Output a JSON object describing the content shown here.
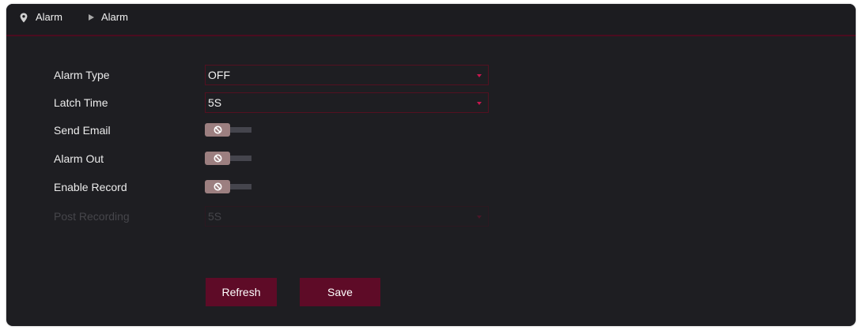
{
  "breadcrumb": {
    "items": [
      "Alarm",
      "Alarm"
    ]
  },
  "form": {
    "alarm_type": {
      "label": "Alarm Type",
      "value": "OFF"
    },
    "latch_time": {
      "label": "Latch Time",
      "value": "5S"
    },
    "send_email": {
      "label": "Send Email",
      "enabled": false
    },
    "alarm_out": {
      "label": "Alarm Out",
      "enabled": false
    },
    "enable_record": {
      "label": "Enable Record",
      "enabled": false
    },
    "post_recording": {
      "label": "Post Recording",
      "value": "5S",
      "disabled": true
    }
  },
  "buttons": {
    "refresh": "Refresh",
    "save": "Save"
  },
  "icons": {
    "breadcrumb_home": "location-pin-icon",
    "breadcrumb_separator": "caret-right-icon",
    "select_arrow": "dropdown-arrow-icon",
    "toggle_off": "ban-icon"
  },
  "colors": {
    "panel_background": "#1e1e22",
    "accent": "#5e0b27",
    "select_border": "#541021",
    "dropdown_arrow": "#c8174f",
    "toggle_knob": "#9c7f80",
    "toggle_track": "#45454d"
  }
}
